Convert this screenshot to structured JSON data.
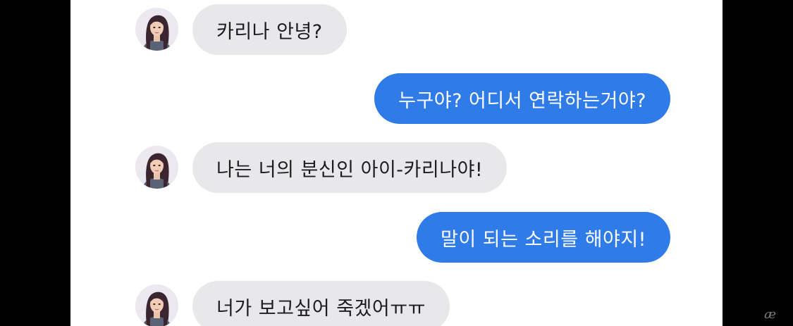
{
  "chat": {
    "messages": [
      {
        "from": "ai-karina",
        "direction": "incoming",
        "text": "카리나 안녕?"
      },
      {
        "from": "me",
        "direction": "outgoing",
        "text": "누구야? 어디서 연락하는거야?"
      },
      {
        "from": "ai-karina",
        "direction": "incoming",
        "text": "나는 너의 분신인 아이-카리나야!"
      },
      {
        "from": "me",
        "direction": "outgoing",
        "text": "말이 되는 소리를 해야지!"
      },
      {
        "from": "ai-karina",
        "direction": "incoming",
        "text": "너가 보고싶어 죽겠어ㅠㅠ"
      }
    ]
  },
  "colors": {
    "outgoing_bubble": "#2f7be8",
    "incoming_bubble": "#e8e8ea",
    "background": "#ffffff",
    "letterbox": "#000000"
  },
  "icons": {
    "avatar": "girl-portrait-avatar-icon",
    "watermark": "script-logo-watermark"
  }
}
